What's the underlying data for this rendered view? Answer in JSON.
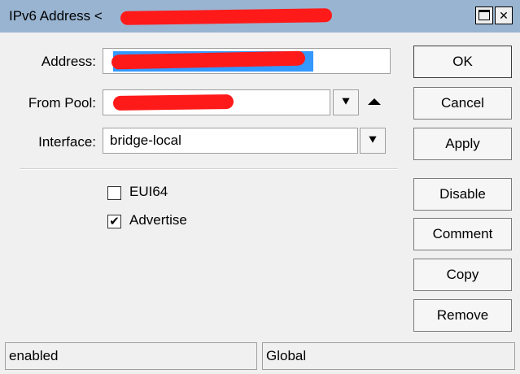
{
  "window": {
    "title": "IPv6 Address <",
    "title_suffix": ">",
    "maximize_label": "",
    "close_label": "✕"
  },
  "form": {
    "address_label": "Address:",
    "address_value": "",
    "from_pool_label": "From Pool:",
    "from_pool_value": "",
    "interface_label": "Interface:",
    "interface_value": "bridge-local",
    "dropdown_glyph": "⯆",
    "eui64_label": "EUI64",
    "eui64_checked": false,
    "advertise_label": "Advertise",
    "advertise_checked": true,
    "check_glyph": "✔"
  },
  "buttons": {
    "ok": "OK",
    "cancel": "Cancel",
    "apply": "Apply",
    "disable": "Disable",
    "comment": "Comment",
    "copy": "Copy",
    "remove": "Remove"
  },
  "status": {
    "left": "enabled",
    "right": "Global"
  },
  "colors": {
    "titlebar": "#99b4d1",
    "selection": "#3399ff",
    "redaction": "#ff1a1a"
  }
}
